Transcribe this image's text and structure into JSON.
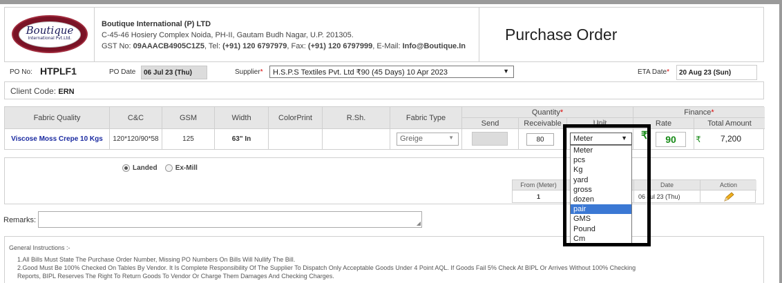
{
  "company": {
    "logo_word": "Boutique",
    "logo_sub": "International Pvt.Ltd.",
    "name": "Boutique International (P) LTD",
    "address": "C-45-46 Hosiery Complex Noida, PH-II, Gautam Budh Nagar, U.P. 201305.",
    "gst_prefix": "GST No: ",
    "gst": "09AAACB4905C1Z5",
    "tel_prefix": ", Tel: ",
    "tel": "(+91) 120 6797979",
    "fax_prefix": ", Fax: ",
    "fax": "(+91) 120 6797999",
    "email_prefix": ", E-Mail: ",
    "email": "Info@Boutique.In"
  },
  "title": "Purchase Order",
  "po": {
    "po_no_label": "PO No:",
    "po_no": "HTPLF1",
    "po_date_label": "PO Date",
    "po_date": "06 Jul 23 (Thu)",
    "supplier_label": "Supplier",
    "supplier_value": "H.S.P.S Textiles Pvt. Ltd ₹90 (45 Days) 10 Apr 2023",
    "eta_label": "ETA Date",
    "eta_value": "20 Aug 23 (Sun)",
    "required_mark": "*"
  },
  "client": {
    "label": "Client Code:",
    "value": "ERN"
  },
  "table": {
    "headers": {
      "fabric_quality": "Fabric Quality",
      "cc": "C&C",
      "gsm": "GSM",
      "width": "Width",
      "colorprint": "ColorPrint",
      "rsh": "R.Sh.",
      "fabric_type": "Fabric Type",
      "quantity": "Quantity",
      "send": "Send",
      "receivable": "Receivable",
      "unit": "Unit",
      "finance": "Finance",
      "rate": "Rate",
      "total_amount": "Total Amount"
    },
    "row": {
      "fabric_quality": "Viscose Moss Crepe 10 Kgs",
      "cc": "120*120/90*58",
      "gsm": "125",
      "width": "63\" In",
      "fabric_type": "Greige",
      "receivable": "80",
      "unit": "Meter",
      "rate_symbol": "₹",
      "rate": "90",
      "total_symbol": "₹",
      "total": "7,200"
    }
  },
  "unit_options": [
    "Meter",
    "pcs",
    "Kg",
    "yard",
    "gross",
    "dozen",
    "pair",
    "GMS",
    "Pound",
    "Cm"
  ],
  "unit_highlighted": "pair",
  "landed": {
    "landed_label": "Landed",
    "exmill_label": "Ex-Mill",
    "selected": "Landed",
    "sub_headers": {
      "from": "From (Meter)",
      "date": "Date",
      "action": "Action"
    },
    "sub_row": {
      "from": "1",
      "date": "06 Jul 23 (Thu)"
    }
  },
  "remarks": {
    "label": "Remarks:"
  },
  "instructions": {
    "title": "General Instructions :-",
    "items": [
      "1.All Bills Must State The Purchase Order Number, Missing PO Numbers On Bills Will Nullify The Bill.",
      "2.Good Must Be 100% Checked On Tables By Vendor. It Is Complete Responsibility Of The Supplier To Dispatch Only Acceptable Goods Under 4 Point AQL. If Goods Fail 5% Check At BIPL Or Arrives Without 100% Checking",
      "Reports, BIPL Reserves The Right To Return Goods To Vendor Or Charge Them Damages And Checking Charges."
    ]
  },
  "colors": {
    "accent_green": "#178a17",
    "link_blue": "#1a2aa0",
    "highlight": "#3b78d4",
    "required_red": "#dd0000"
  }
}
